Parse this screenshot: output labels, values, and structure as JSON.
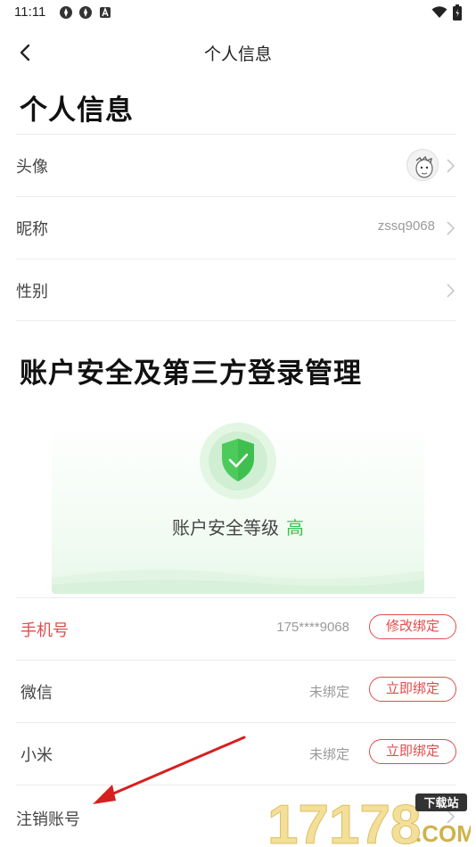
{
  "status_bar": {
    "time": "11:11"
  },
  "nav": {
    "title": "个人信息"
  },
  "profile": {
    "heading": "个人信息",
    "rows": [
      {
        "label": "头像",
        "value": ""
      },
      {
        "label": "昵称",
        "value": "zssq9068"
      },
      {
        "label": "性别",
        "value": ""
      }
    ]
  },
  "security": {
    "heading": "账户安全及第三方登录管理",
    "level_label": "账户安全等级",
    "level_value": "高",
    "accounts": [
      {
        "label": "手机号",
        "value": "175****9068",
        "button": "修改绑定"
      },
      {
        "label": "微信",
        "value": "未绑定",
        "button": "立即绑定"
      },
      {
        "label": "小米",
        "value": "未绑定",
        "button": "立即绑定"
      }
    ],
    "cancel_label": "注销账号"
  },
  "watermark": {
    "number": "17178",
    "badge": "下载站",
    "domain": ".COM"
  },
  "colors": {
    "accent_red": "#e24b4b",
    "safe_green": "#3fbf4f",
    "arrow_red": "#d62020"
  },
  "icons": [
    "back-arrow-icon",
    "chevron-right-icon",
    "shield-check-icon",
    "wifi-icon",
    "battery-icon",
    "avatar-image"
  ]
}
